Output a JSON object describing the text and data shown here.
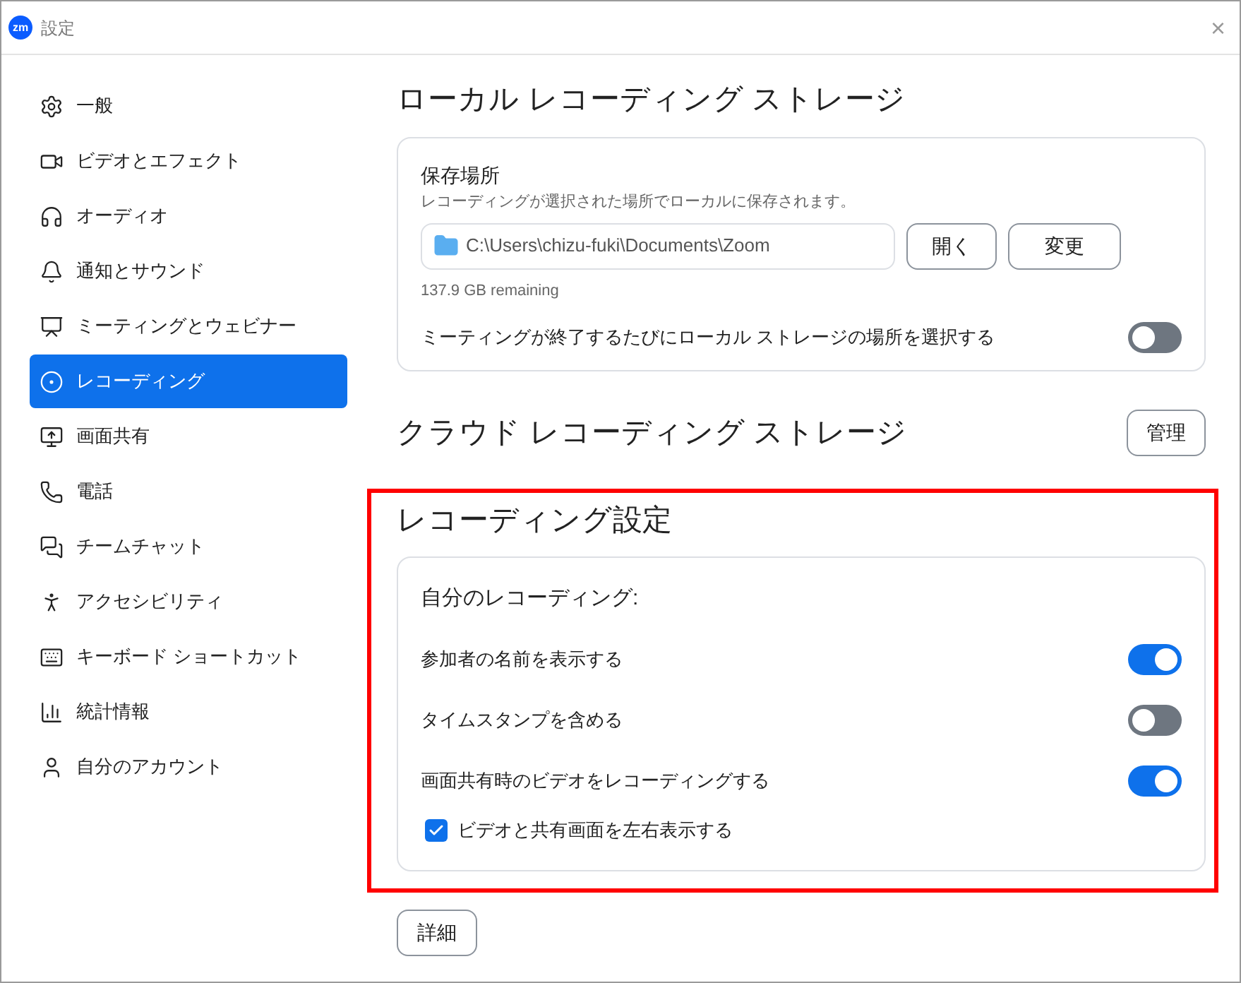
{
  "window": {
    "title": "設定",
    "logo": "zm",
    "close": "×"
  },
  "sidebar": {
    "items": [
      {
        "label": "一般",
        "selected": false
      },
      {
        "label": "ビデオとエフェクト",
        "selected": false
      },
      {
        "label": "オーディオ",
        "selected": false
      },
      {
        "label": "通知とサウンド",
        "selected": false
      },
      {
        "label": "ミーティングとウェビナー",
        "selected": false
      },
      {
        "label": "レコーディング",
        "selected": true
      },
      {
        "label": "画面共有",
        "selected": false
      },
      {
        "label": "電話",
        "selected": false
      },
      {
        "label": "チームチャット",
        "selected": false
      },
      {
        "label": "アクセシビリティ",
        "selected": false
      },
      {
        "label": "キーボード ショートカット",
        "selected": false
      },
      {
        "label": "統計情報",
        "selected": false
      },
      {
        "label": "自分のアカウント",
        "selected": false
      }
    ]
  },
  "local_storage": {
    "heading": "ローカル レコーディング ストレージ",
    "location_label": "保存場所",
    "description": "レコーディングが選択された場所でローカルに保存されます。",
    "path": "C:\\Users\\chizu-fuki\\Documents\\Zoom",
    "buttons": [
      "開く",
      "変更"
    ],
    "remaining": "137.9 GB remaining",
    "choose_each_time": {
      "label": "ミーティングが終了するたびにローカル ストレージの場所を選択する",
      "on": false
    }
  },
  "cloud_storage": {
    "heading": "クラウド レコーディング ストレージ",
    "button": "管理"
  },
  "recording_settings": {
    "heading": "レコーディング設定",
    "group_label": "自分のレコーディング:",
    "options": [
      {
        "kind": "toggle",
        "label": "参加者の名前を表示する",
        "on": true
      },
      {
        "kind": "toggle",
        "label": "タイムスタンプを含める",
        "on": false
      },
      {
        "kind": "toggle",
        "label": "画面共有時のビデオをレコーディングする",
        "on": true
      },
      {
        "kind": "checkbox",
        "label": "ビデオと共有画面を左右表示する",
        "checked": true
      }
    ]
  },
  "details_button": "詳細"
}
